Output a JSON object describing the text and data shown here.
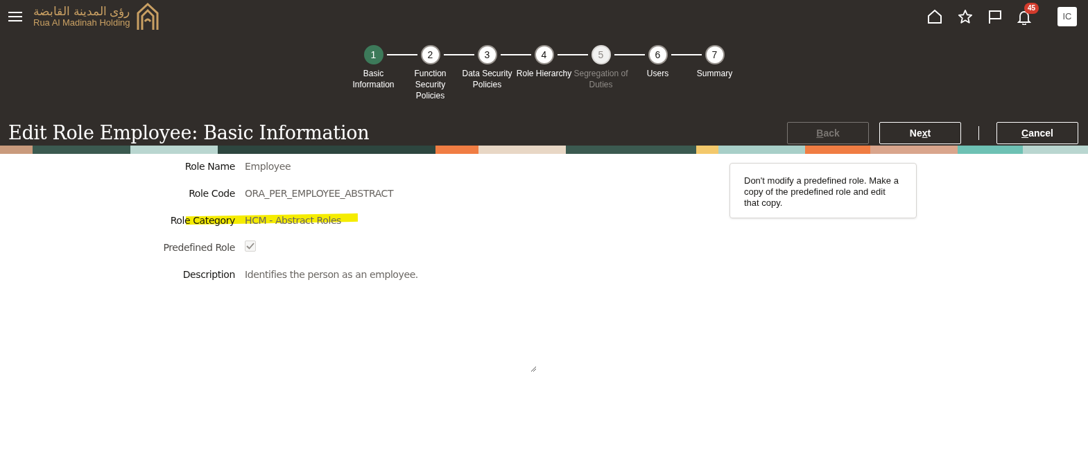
{
  "header": {
    "brand_arabic": "رؤى المدينة القابضة",
    "brand_english": "Rua Al Madinah Holding",
    "notification_count": "45",
    "avatar_initials": "IC"
  },
  "steps": [
    {
      "number": "1",
      "label": "Basic Information",
      "selected": true,
      "disabled": false
    },
    {
      "number": "2",
      "label": "Function Security Policies",
      "selected": false,
      "disabled": false
    },
    {
      "number": "3",
      "label": "Data Security Policies",
      "selected": false,
      "disabled": false
    },
    {
      "number": "4",
      "label": "Role Hierarchy",
      "selected": false,
      "disabled": false
    },
    {
      "number": "5",
      "label": "Segregation of Duties",
      "selected": false,
      "disabled": true
    },
    {
      "number": "6",
      "label": "Users",
      "selected": false,
      "disabled": false
    },
    {
      "number": "7",
      "label": "Summary",
      "selected": false,
      "disabled": false
    }
  ],
  "page_title": "Edit Role Employee: Basic Information",
  "buttons": [
    {
      "key": "B",
      "after": "ack",
      "disabled": true
    },
    {
      "before": "Ne",
      "key": "x",
      "after": "t",
      "disabled": false
    },
    {
      "key": "C",
      "after": "ancel",
      "disabled": false
    }
  ],
  "fields": [
    {
      "kind": "text",
      "label": "Role Name",
      "value": "Employee",
      "highlighted": false
    },
    {
      "kind": "text",
      "label": "Role Code",
      "value": "ORA_PER_EMPLOYEE_ABSTRACT",
      "highlighted": false
    },
    {
      "kind": "text",
      "label": "Role Category",
      "value": "HCM - Abstract Roles",
      "highlighted": true
    },
    {
      "kind": "checkbox",
      "label": "Predefined Role",
      "checked": true,
      "disabled": true,
      "highlighted": false
    },
    {
      "kind": "textarea",
      "label": "Description",
      "value": "Identifies the person as an employee.",
      "highlighted": false
    }
  ],
  "note": "Don't modify a predefined role. Make a copy of the predefined role and edit that copy."
}
